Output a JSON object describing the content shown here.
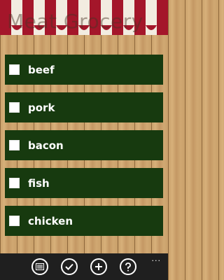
{
  "app": {
    "title": "Meat Grocery"
  },
  "items": [
    {
      "label": "beef",
      "checked": false
    },
    {
      "label": "pork",
      "checked": false
    },
    {
      "label": "bacon",
      "checked": false
    },
    {
      "label": "fish",
      "checked": false
    },
    {
      "label": "chicken",
      "checked": false
    }
  ],
  "app_bar": {
    "buttons": [
      {
        "icon": "list-icon"
      },
      {
        "icon": "check-icon"
      },
      {
        "icon": "add-icon"
      },
      {
        "icon": "help-icon"
      }
    ],
    "more_label": "..."
  },
  "colors": {
    "item_background": "#173a0f",
    "awning_red": "#a4162a",
    "awning_white": "#f2ece0",
    "app_bar": "#1f1f1f"
  }
}
